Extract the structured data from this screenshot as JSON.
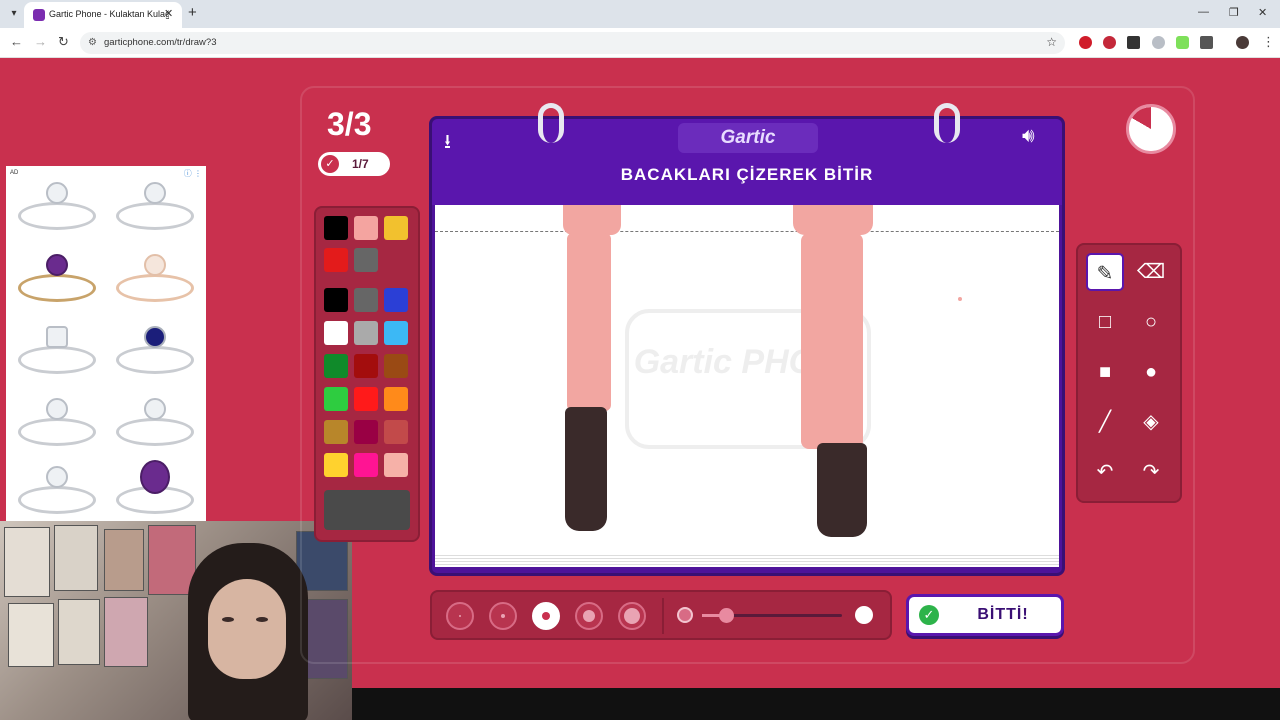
{
  "browser": {
    "tab_title": "Gartic Phone - Kulaktan Kulağa",
    "url": "garticphone.com/tr/draw?3",
    "new_tab": "+",
    "tab_close": "✕"
  },
  "ad": {
    "label": "AD",
    "info": "ⓘ ⋮"
  },
  "game": {
    "round": "3/3",
    "players_done": "1/7",
    "logo": "Gartic",
    "prompt": "BACAKLARI ÇİZEREK BİTİR",
    "watermark": "Gartic PHONE",
    "done_button": "BİTTİ!"
  },
  "palette": {
    "colors": [
      "#000000",
      "#f4a4a0",
      "#f2c12e",
      "#e31b1b",
      "#666666",
      "#000000",
      "#666666",
      "#2b3fd6",
      "#ffffff",
      "#aaaaaa",
      "#3cb8f5",
      "#108a2a",
      "#a30d0d",
      "#9a4a14",
      "#2ecc40",
      "#ff1a1a",
      "#ff8a1a",
      "#b8862a",
      "#990044",
      "#c24a4a",
      "#ffd22e",
      "#ff1493",
      "#f6b1a8"
    ],
    "selected_color": "#4a4a4a"
  },
  "tools": {
    "items": [
      "pen-tool",
      "eraser-tool",
      "rect-outline-tool",
      "circle-outline-tool",
      "rect-fill-tool",
      "circle-fill-tool",
      "line-tool",
      "fill-bucket-tool",
      "undo-tool",
      "redo-tool"
    ],
    "active": "pen-tool"
  },
  "brush": {
    "sizes": [
      1,
      2,
      3,
      4,
      5
    ],
    "selected_size": 3,
    "opacity": 0.15
  },
  "timer": {
    "remaining_fraction": 0.83
  }
}
